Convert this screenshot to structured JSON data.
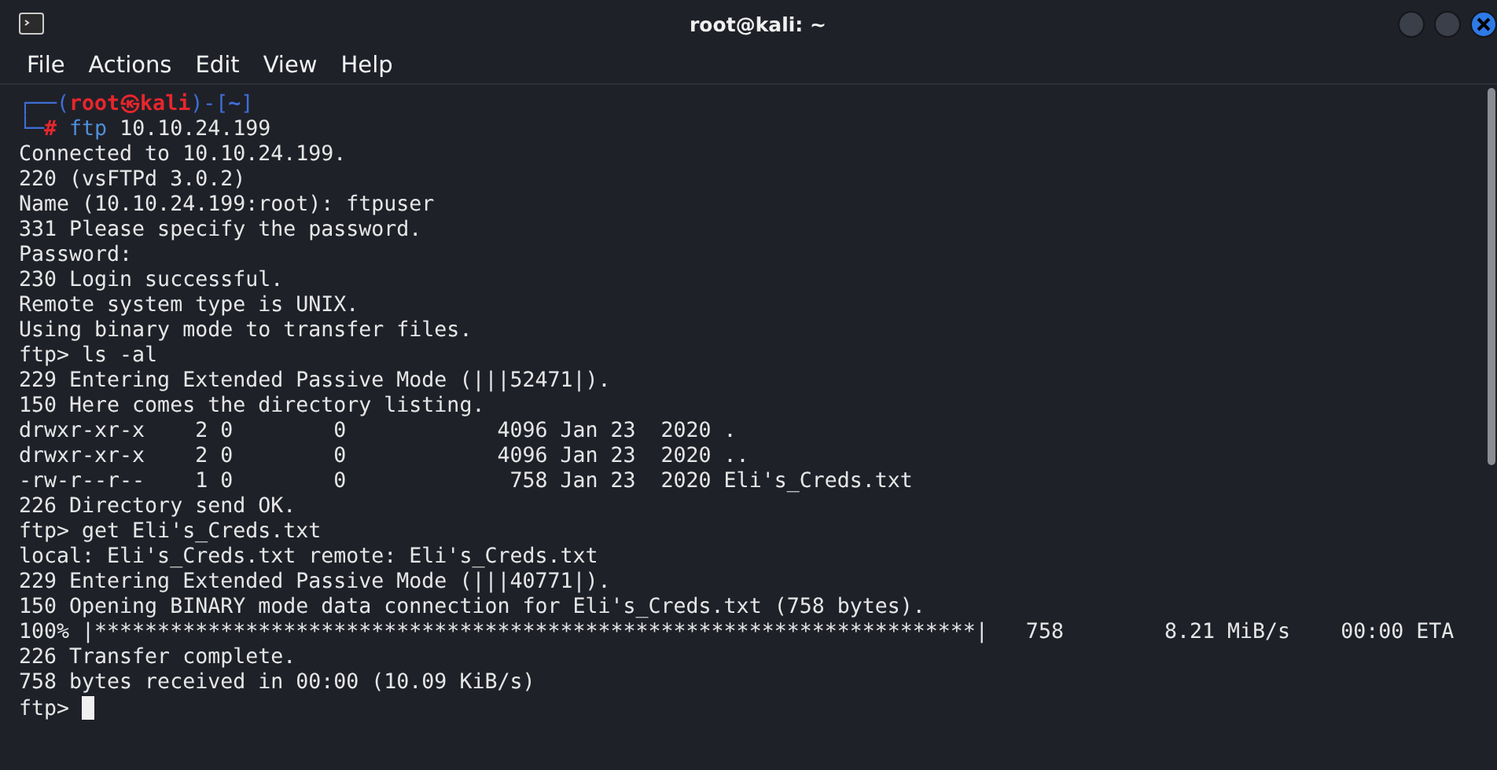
{
  "window": {
    "title": "root@kali: ~"
  },
  "menu": [
    "File",
    "Actions",
    "Edit",
    "View",
    "Help"
  ],
  "prompt": [
    {
      "segments": [
        {
          "text": "┌──(",
          "kind": "frame"
        },
        {
          "text": "root㉿kali",
          "kind": "user"
        },
        {
          "text": ")-[",
          "kind": "frame"
        },
        {
          "text": "~",
          "kind": "path"
        },
        {
          "text": "]",
          "kind": "frame"
        }
      ]
    },
    {
      "segments": [
        {
          "text": "└─",
          "kind": "frame"
        },
        {
          "text": "#",
          "kind": "user"
        },
        {
          "text": " ftp",
          "kind": "command"
        },
        {
          "text": " 10.10.24.199",
          "kind": "plain"
        }
      ]
    }
  ],
  "output": [
    "Connected to 10.10.24.199.",
    "220 (vsFTPd 3.0.2)",
    "Name (10.10.24.199:root): ftpuser",
    "331 Please specify the password.",
    "Password:",
    "230 Login successful.",
    "Remote system type is UNIX.",
    "Using binary mode to transfer files.",
    "ftp> ls -al",
    "229 Entering Extended Passive Mode (|||52471|).",
    "150 Here comes the directory listing.",
    "drwxr-xr-x    2 0        0            4096 Jan 23  2020 .",
    "drwxr-xr-x    2 0        0            4096 Jan 23  2020 ..",
    "-rw-r--r--    1 0        0             758 Jan 23  2020 Eli's_Creds.txt",
    "226 Directory send OK.",
    "ftp> get Eli's_Creds.txt",
    "local: Eli's_Creds.txt remote: Eli's_Creds.txt",
    "229 Entering Extended Passive Mode (|||40771|).",
    "150 Opening BINARY mode data connection for Eli's_Creds.txt (758 bytes).",
    "100% |**********************************************************************|   758        8.21 MiB/s    00:00 ETA",
    "226 Transfer complete.",
    "758 bytes received in 00:00 (10.09 KiB/s)",
    "ftp> "
  ],
  "cursor": {
    "visible": true
  }
}
